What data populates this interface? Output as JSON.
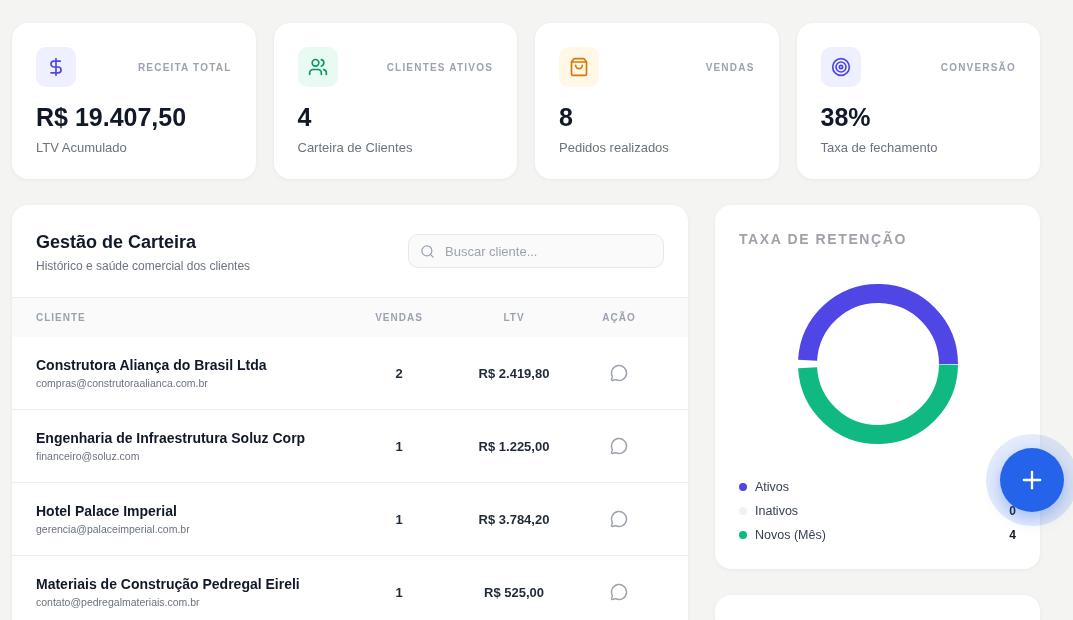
{
  "stats": [
    {
      "label": "RECEITA TOTAL",
      "value": "R$ 19.407,50",
      "caption": "LTV Acumulado"
    },
    {
      "label": "CLIENTES ATIVOS",
      "value": "4",
      "caption": "Carteira de Clientes"
    },
    {
      "label": "VENDAS",
      "value": "8",
      "caption": "Pedidos realizados"
    },
    {
      "label": "CONVERSÃO",
      "value": "38%",
      "caption": "Taxa de fechamento"
    }
  ],
  "portfolio": {
    "title": "Gestão de Carteira",
    "subtitle": "Histórico e saúde comercial dos clientes",
    "search": {
      "placeholder": "Buscar cliente..."
    },
    "columns": [
      "CLIENTE",
      "VENDAS",
      "LTV",
      "AÇÃO"
    ],
    "rows": [
      {
        "name": "Construtora Aliança do Brasil Ltda",
        "email": "compras@construtoraalianca.com.br",
        "sales": "2",
        "ltv": "R$ 2.419,80"
      },
      {
        "name": "Engenharia de Infraestrutura Soluz Corp",
        "email": "financeiro@soluz.com",
        "sales": "1",
        "ltv": "R$ 1.225,00"
      },
      {
        "name": "Hotel Palace Imperial",
        "email": "gerencia@palaceimperial.com.br",
        "sales": "1",
        "ltv": "R$ 3.784,20"
      },
      {
        "name": "Materiais de Construção Pedregal Eireli",
        "email": "contato@pedregalmateriais.com.br",
        "sales": "1",
        "ltv": "R$ 525,00"
      }
    ]
  },
  "retention": {
    "title": "TAXA DE RETENÇÃO",
    "legend": [
      {
        "label": "Ativos",
        "color": "#4f46e5"
      },
      {
        "label": "Inativos",
        "color": "#f1f1f3",
        "value": "0"
      },
      {
        "label": "Novos (Mês)",
        "color": "#10b981",
        "value": "4"
      }
    ]
  }
}
